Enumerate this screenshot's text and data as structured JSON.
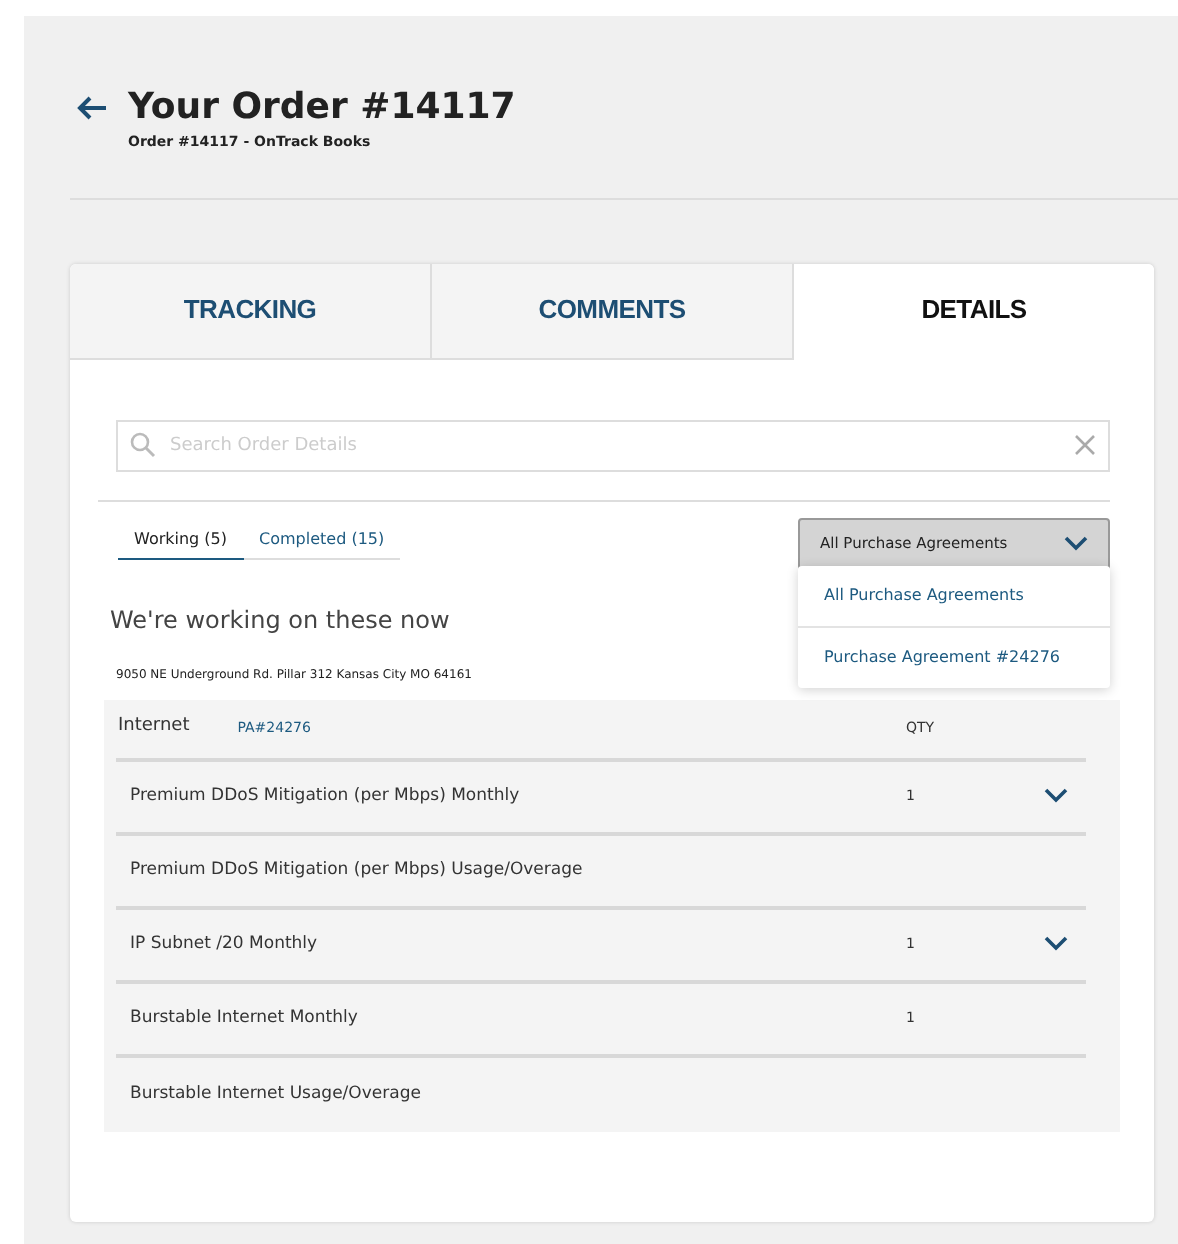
{
  "header": {
    "title": "Your Order #14117",
    "subtitle": "Order #14117 - OnTrack Books"
  },
  "tabs": [
    {
      "label": "TRACKING",
      "selected": false
    },
    {
      "label": "COMMENTS",
      "selected": false
    },
    {
      "label": "DETAILS",
      "selected": true
    }
  ],
  "search": {
    "placeholder": "Search Order Details"
  },
  "subtabs": [
    {
      "label": "Working (5)",
      "selected": true
    },
    {
      "label": "Completed (15)",
      "selected": false
    }
  ],
  "agreement_filter": {
    "value": "All Purchase Agreements",
    "expanded": true,
    "options": [
      "All Purchase Agreements",
      "Purchase Agreement #24276"
    ]
  },
  "heading": "We're working on these now",
  "address": "9050 NE Underground Rd. Pillar 312 Kansas City MO 64161",
  "table": {
    "group": "Internet",
    "agreement": "PA#24276",
    "qty_header": "QTY",
    "rows": [
      {
        "name": "Premium DDoS Mitigation (per Mbps) Monthly",
        "qty": "1",
        "expandable": true
      },
      {
        "name": "Premium DDoS Mitigation (per Mbps) Usage/Overage",
        "expandable": false
      },
      {
        "name": "IP Subnet /20 Monthly",
        "qty": "1",
        "expandable": true
      },
      {
        "name": "Burstable Internet Monthly",
        "qty": "1",
        "expandable": false
      },
      {
        "name": "Burstable Internet Usage/Overage",
        "expandable": false
      }
    ]
  }
}
